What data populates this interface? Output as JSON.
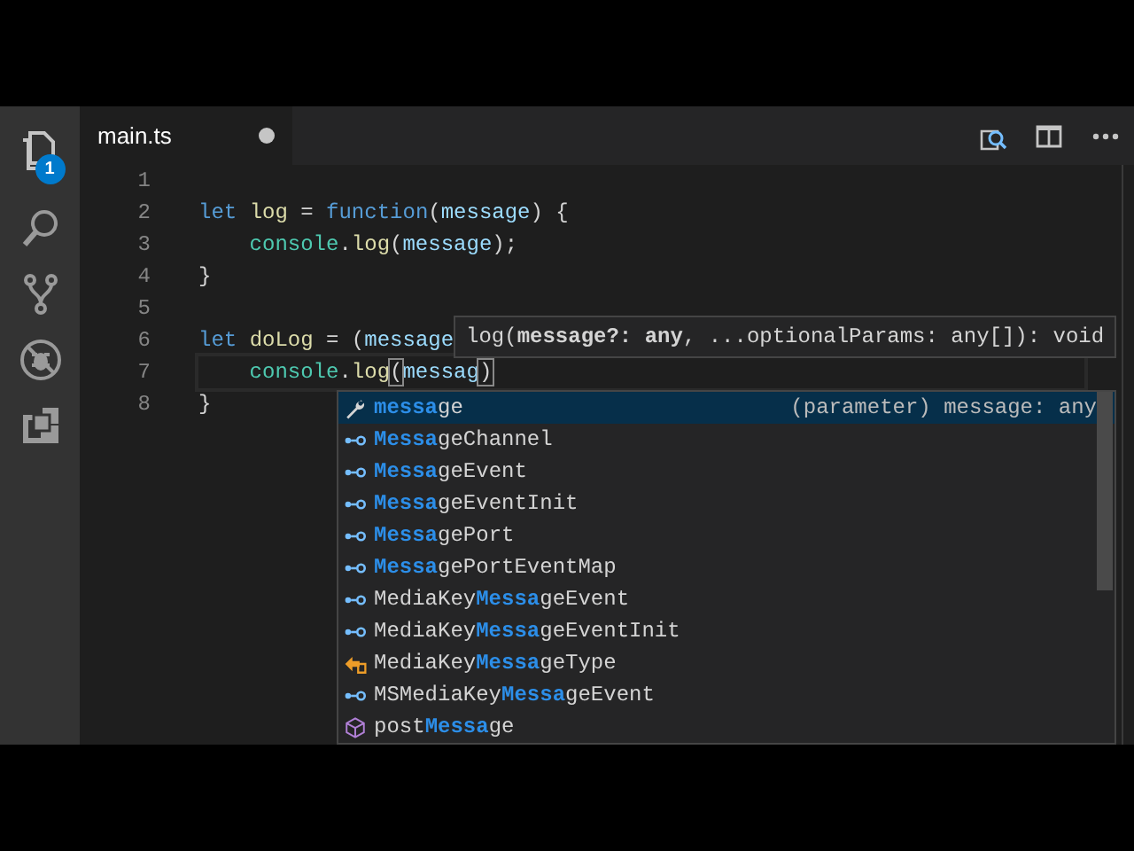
{
  "activity_bar": {
    "explorer_badge": "1"
  },
  "tab": {
    "label": "main.ts",
    "dirty": true
  },
  "editor": {
    "lines": [
      {
        "number": "1"
      },
      {
        "number": "2",
        "indented": false,
        "current": false,
        "tokens": [
          {
            "kind": "keyword",
            "text": "let "
          },
          {
            "kind": "function",
            "text": "log"
          },
          {
            "kind": "plain",
            "text": " = "
          },
          {
            "kind": "keyword",
            "text": "function"
          },
          {
            "kind": "plain",
            "text": "("
          },
          {
            "kind": "variable",
            "text": "message"
          },
          {
            "kind": "plain",
            "text": ") {"
          }
        ]
      },
      {
        "number": "3",
        "indented": true,
        "current": false,
        "tokens": [
          {
            "kind": "type",
            "text": "console"
          },
          {
            "kind": "plain",
            "text": "."
          },
          {
            "kind": "function",
            "text": "log"
          },
          {
            "kind": "plain",
            "text": "("
          },
          {
            "kind": "variable",
            "text": "message"
          },
          {
            "kind": "plain",
            "text": ");"
          }
        ]
      },
      {
        "number": "4",
        "indented": false,
        "current": false,
        "tokens": [
          {
            "kind": "plain",
            "text": "}"
          }
        ]
      },
      {
        "number": "5"
      },
      {
        "number": "6",
        "indented": false,
        "current": false,
        "tokens": [
          {
            "kind": "keyword",
            "text": "let "
          },
          {
            "kind": "function",
            "text": "doLog"
          },
          {
            "kind": "plain",
            "text": " = ("
          },
          {
            "kind": "variable",
            "text": "message"
          }
        ]
      },
      {
        "number": "7",
        "indented": true,
        "current": true,
        "tokens": [
          {
            "kind": "type",
            "text": "console"
          },
          {
            "kind": "plain",
            "text": "."
          },
          {
            "kind": "function",
            "text": "log"
          },
          {
            "kind": "bracket",
            "text": "("
          },
          {
            "kind": "variable",
            "text": "messag"
          },
          {
            "kind": "bracket",
            "text": ")"
          }
        ]
      },
      {
        "number": "8",
        "indented": false,
        "current": false,
        "tokens": [
          {
            "kind": "plain",
            "text": "}"
          }
        ]
      }
    ]
  },
  "hover": {
    "signature": "log(**message?: any**, ...optionalParams: any[]): void"
  },
  "suggestions": [
    {
      "kind": "parameter",
      "match": "messa",
      "after": "ge",
      "selected": true,
      "detail": "(parameter) message: any"
    },
    {
      "kind": "interface",
      "match": "Messa",
      "after": "geChannel",
      "selected": false
    },
    {
      "kind": "interface",
      "match": "Messa",
      "after": "geEvent",
      "selected": false
    },
    {
      "kind": "interface",
      "match": "Messa",
      "after": "geEventInit",
      "selected": false
    },
    {
      "kind": "interface",
      "match": "Messa",
      "after": "gePort",
      "selected": false
    },
    {
      "kind": "interface",
      "match": "Messa",
      "after": "gePortEventMap",
      "selected": false
    },
    {
      "kind": "interface",
      "before": "MediaKey",
      "match": "Messa",
      "after": "geEvent",
      "selected": false
    },
    {
      "kind": "interface",
      "before": "MediaKey",
      "match": "Messa",
      "after": "geEventInit",
      "selected": false
    },
    {
      "kind": "enum",
      "before": "MediaKey",
      "match": "Messa",
      "after": "geType",
      "selected": false
    },
    {
      "kind": "interface",
      "before": "MSMediaKey",
      "match": "Messa",
      "after": "geEvent",
      "selected": false
    },
    {
      "kind": "method",
      "before": "post",
      "match": "Messa",
      "after": "ge",
      "selected": false
    }
  ]
}
